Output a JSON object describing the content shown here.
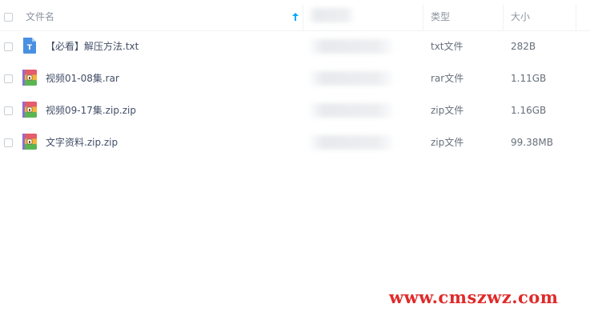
{
  "header": {
    "name_label": "文件名",
    "type_label": "类型",
    "size_label": "大小"
  },
  "files": [
    {
      "name": "【必看】解压方法.txt",
      "type": "txt文件",
      "size": "282B",
      "icon": "text-file-icon"
    },
    {
      "name": "视频01-08集.rar",
      "type": "rar文件",
      "size": "1.11GB",
      "icon": "archive-file-icon"
    },
    {
      "name": "视频09-17集.zip.zip",
      "type": "zip文件",
      "size": "1.16GB",
      "icon": "archive-file-icon"
    },
    {
      "name": "文字资料.zip.zip",
      "type": "zip文件",
      "size": "99.38MB",
      "icon": "archive-file-icon"
    }
  ],
  "watermark": "www.cmszwz.com",
  "colors": {
    "accent": "#06a7ff",
    "watermark": "#e02a2a",
    "text_icon": "#4a90e2"
  }
}
